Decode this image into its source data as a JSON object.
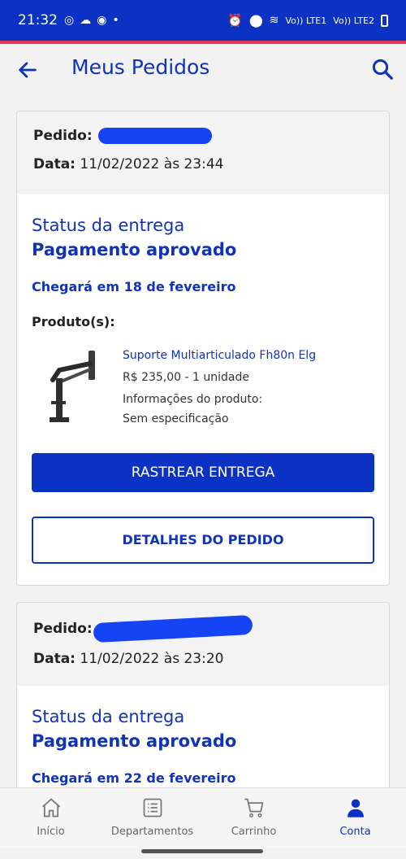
{
  "statusbar": {
    "time": "21:32",
    "network_1": "Vo)) LTE1",
    "network_2": "Vo)) LTE2"
  },
  "appbar": {
    "title": "Meus Pedidos"
  },
  "orders": [
    {
      "order_label": "Pedido:",
      "date_label": "Data:",
      "date_value": "11/02/2022 às 23:44",
      "status_label": "Status da entrega",
      "status_value": "Pagamento aprovado",
      "arrival": "Chegará em 18 de fevereiro",
      "products_label": "Produto(s):",
      "product": {
        "name": "Suporte Multiarticulado Fh80n Elg",
        "price": "R$ 235,00 - 1 unidade",
        "info_label": "Informações do produto:",
        "info_value": "Sem especificação"
      },
      "track_button": "RASTREAR ENTREGA",
      "details_button": "DETALHES DO PEDIDO"
    },
    {
      "order_label": "Pedido:",
      "date_label": "Data:",
      "date_value": "11/02/2022 às 23:20",
      "status_label": "Status da entrega",
      "status_value": "Pagamento aprovado",
      "arrival": "Chegará em 22 de fevereiro"
    }
  ],
  "nav": [
    {
      "label": "Início",
      "icon": "home-icon"
    },
    {
      "label": "Departamentos",
      "icon": "list-icon"
    },
    {
      "label": "Carrinho",
      "icon": "cart-icon"
    },
    {
      "label": "Conta",
      "icon": "user-icon",
      "active": true
    }
  ],
  "colors": {
    "primary": "#0b32c2",
    "text_blue": "#1033b8",
    "accent_line": "#e53950"
  }
}
